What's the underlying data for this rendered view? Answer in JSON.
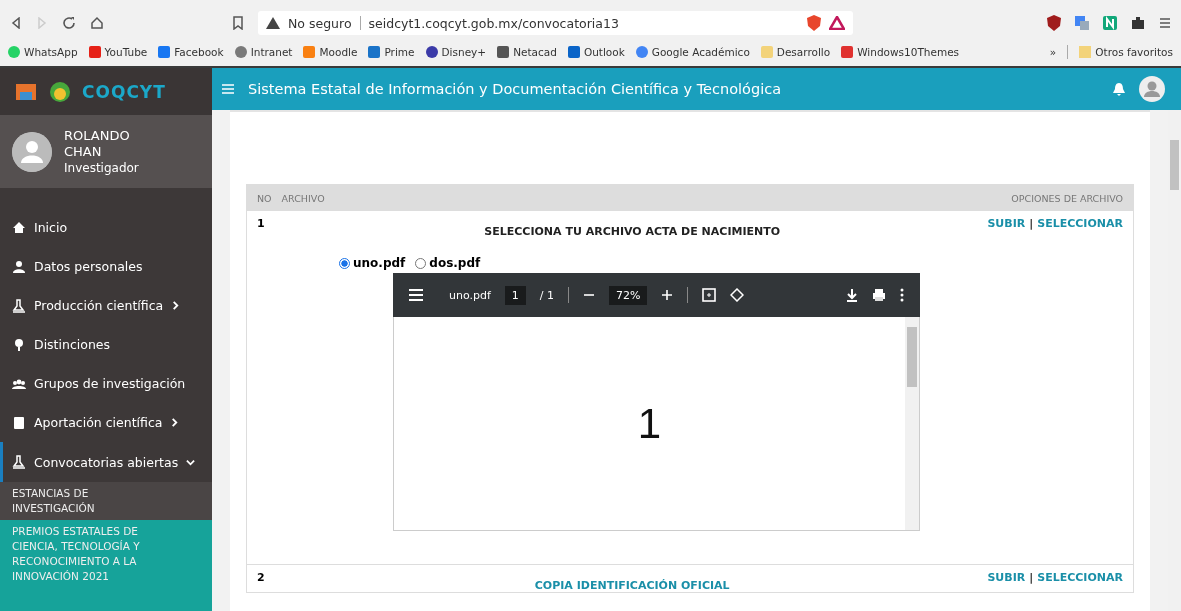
{
  "browser": {
    "security": "No seguro",
    "url": "seidcyt1.coqcyt.gob.mx/convocatoria13",
    "bookmarks": [
      {
        "label": "WhatsApp",
        "color": "#25d366"
      },
      {
        "label": "YouTube",
        "color": "#e62117"
      },
      {
        "label": "Facebook",
        "color": "#1877f2"
      },
      {
        "label": "Intranet",
        "color": "#7a7a7a"
      },
      {
        "label": "Moodle",
        "color": "#f98012"
      },
      {
        "label": "Prime",
        "color": "#1a73c8"
      },
      {
        "label": "Disney+",
        "color": "#3b3aa8"
      },
      {
        "label": "Netacad",
        "color": "#555555"
      },
      {
        "label": "Outlook",
        "color": "#0a64c8"
      },
      {
        "label": "Google Académico",
        "color": "#4285f4"
      },
      {
        "label": "Desarrollo",
        "color": "#f3d37a"
      },
      {
        "label": "Windows10Themes",
        "color": "#e0312f"
      }
    ],
    "overflow": "»",
    "other_bookmarks": "Otros favoritos"
  },
  "app": {
    "logo_text": "COQCYT",
    "title": "Sistema Estatal de Información y Documentación Científica y Tecnológica"
  },
  "user": {
    "name": "ROLANDO CHAN",
    "role": "Investigador"
  },
  "sidebar": {
    "items": [
      {
        "label": "Inicio"
      },
      {
        "label": "Datos personales"
      },
      {
        "label": "Producción científica",
        "expanded": false
      },
      {
        "label": "Distinciones"
      },
      {
        "label": "Grupos de investigación"
      },
      {
        "label": "Aportación científica",
        "expanded": false
      },
      {
        "label": "Convocatorias abiertas",
        "expanded": true,
        "children": [
          {
            "label": "ESTANCIAS DE INVESTIGACIÓN",
            "selected": false
          },
          {
            "label": "PREMIOS ESTATALES DE CIENCIA, TECNOLOGÍA Y RECONOCIMIENTO A LA INNOVACIÓN 2021",
            "selected": true
          }
        ]
      }
    ]
  },
  "table": {
    "columns": [
      "NO",
      "ARCHIVO",
      "OPCIONES DE ARCHIVO"
    ],
    "rows": [
      {
        "no": "1",
        "title": "SELECCIONA TU ARCHIVO ACTA DE NACIMIENTO",
        "actions": [
          "SUBIR",
          "SELECCIONAR"
        ],
        "separator": "|",
        "files": [
          {
            "label": "uno.pdf",
            "selected": true
          },
          {
            "label": "dos.pdf",
            "selected": false
          }
        ],
        "viewer": {
          "filename": "uno.pdf",
          "page": "1",
          "page_count": "/ 1",
          "zoom": "72%",
          "page_content": "1"
        }
      },
      {
        "no": "2",
        "title": "COPIA IDENTIFICACIÓN OFICIAL",
        "actions": [
          "SUBIR",
          "SELECCIONAR"
        ],
        "separator": "|"
      }
    ]
  }
}
